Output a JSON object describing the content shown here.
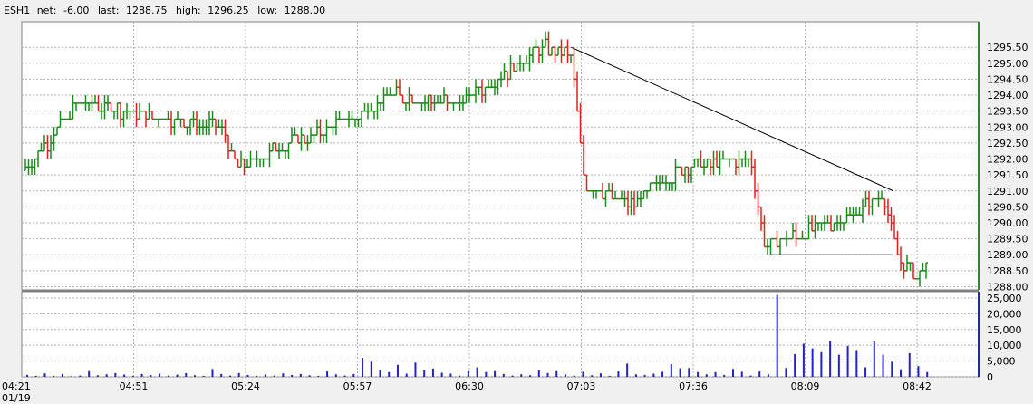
{
  "header": {
    "symbol": "ESH1",
    "net_label": "net:",
    "net": "-6.00",
    "last_label": "last:",
    "last": "1288.75",
    "high_label": "high:",
    "high": "1296.25",
    "low_label": "low:",
    "low": "1288.00"
  },
  "colors": {
    "up": "#1a8a1a",
    "down": "#e02020",
    "volume": "#2222cc",
    "grid": "#b0b0b0",
    "trendline": "#000000",
    "axis_accent": "#2a8a2a"
  },
  "chart_data": [
    {
      "type": "ohlc",
      "symbol": "ESH1",
      "x_ticks": [
        "04:21",
        "04:51",
        "05:24",
        "05:57",
        "06:30",
        "07:03",
        "07:36",
        "08:09",
        "08:42"
      ],
      "x_date_label": "01/19",
      "y_ticks": [
        "1288.00",
        "1288.50",
        "1289.00",
        "1289.50",
        "1290.00",
        "1290.50",
        "1291.00",
        "1291.50",
        "1292.00",
        "1292.50",
        "1293.00",
        "1293.50",
        "1294.00",
        "1294.50",
        "1295.00",
        "1295.50"
      ],
      "ylim": [
        1287.9,
        1296.3
      ],
      "grid": true,
      "key_points": [
        {
          "t": "04:21",
          "price": 1291.5
        },
        {
          "t": "04:38",
          "price": 1293.75
        },
        {
          "t": "05:20",
          "price": 1293.0
        },
        {
          "t": "05:24",
          "price": 1291.75
        },
        {
          "t": "05:57",
          "price": 1293.25
        },
        {
          "t": "06:10",
          "price": 1294.0
        },
        {
          "t": "06:30",
          "price": 1293.75
        },
        {
          "t": "06:55",
          "price": 1295.5
        },
        {
          "t": "07:03",
          "price": 1295.25
        },
        {
          "t": "07:07",
          "price": 1291.25
        },
        {
          "t": "07:20",
          "price": 1290.5
        },
        {
          "t": "07:36",
          "price": 1291.75
        },
        {
          "t": "07:56",
          "price": 1292.0
        },
        {
          "t": "08:00",
          "price": 1289.25
        },
        {
          "t": "08:20",
          "price": 1290.0
        },
        {
          "t": "08:30",
          "price": 1290.5
        },
        {
          "t": "08:35",
          "price": 1291.0
        },
        {
          "t": "08:39",
          "price": 1289.0
        },
        {
          "t": "08:45",
          "price": 1288.25
        },
        {
          "t": "08:48",
          "price": 1288.75
        }
      ],
      "trendlines": [
        {
          "from": {
            "t": "07:03",
            "price": 1295.5
          },
          "to": {
            "t": "08:38",
            "price": 1291.0
          }
        },
        {
          "from": {
            "t": "08:02",
            "price": 1289.0
          },
          "to": {
            "t": "08:38",
            "price": 1289.0
          }
        }
      ]
    },
    {
      "type": "bar",
      "name": "volume",
      "y_ticks": [
        "0",
        "5,000",
        "10,000",
        "15,000",
        "20,000",
        "25,000"
      ],
      "ylim": [
        0,
        27000
      ],
      "values": [
        600,
        300,
        1100,
        300,
        900,
        200,
        400,
        1800,
        500,
        800,
        1200,
        700,
        300,
        900,
        600,
        1000,
        400,
        700,
        1200,
        500,
        300,
        2500,
        900,
        400,
        1200,
        600,
        300,
        800,
        400,
        1100,
        600,
        900,
        500,
        300,
        1700,
        800,
        400,
        900,
        6000,
        4800,
        2300,
        1500,
        3800,
        1000,
        4500,
        2000,
        2600,
        1300,
        1000,
        400,
        1800,
        3000,
        1500,
        1800,
        900,
        400,
        800,
        500,
        2000,
        1200,
        1800,
        800,
        400,
        1600,
        500,
        1100,
        300,
        1700,
        4200,
        800,
        600,
        1000,
        1600,
        4000,
        2700,
        2800,
        1500,
        800,
        1500,
        600,
        2500,
        1600,
        400,
        1700,
        800,
        26000,
        2800,
        7200,
        10500,
        9000,
        7800,
        11500,
        7000,
        9800,
        8500,
        3000,
        11200,
        7000,
        4800,
        2400,
        7500,
        3400,
        1500
      ]
    }
  ]
}
